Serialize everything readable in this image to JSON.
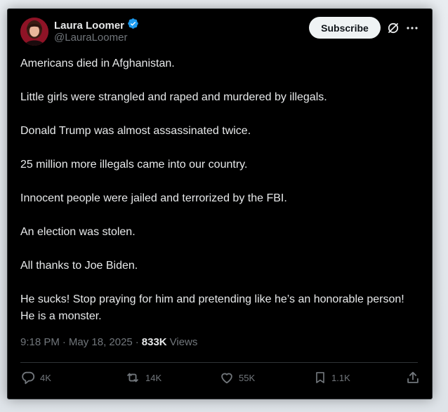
{
  "author": {
    "name": "Laura Loomer",
    "handle": "@LauraLoomer"
  },
  "header": {
    "subscribe_label": "Subscribe"
  },
  "tweet": {
    "paragraphs": [
      "Americans died in Afghanistan.",
      "Little girls were strangled and raped and murdered by illegals.",
      "Donald Trump was almost assassinated twice.",
      "25 million more illegals came into our country.",
      "Innocent people were jailed and terrorized by the FBI.",
      "An election was stolen.",
      "All thanks to Joe Biden.",
      "He sucks! Stop praying for him and pretending like he’s an honorable person! He is a monster."
    ],
    "time": "9:18 PM",
    "date": "May 18, 2025",
    "views_count": "833K",
    "views_label": "Views"
  },
  "actions": {
    "replies": "4K",
    "reposts": "14K",
    "likes": "55K",
    "bookmarks": "1.1K"
  },
  "colors": {
    "background": "#000000",
    "text": "#e7e9ea",
    "muted": "#71767b",
    "verified": "#1d9bf0"
  }
}
